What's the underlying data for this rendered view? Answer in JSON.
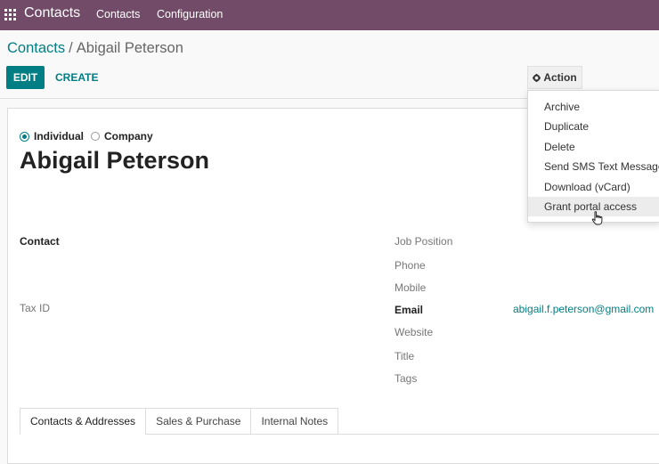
{
  "navbar": {
    "app_title": "Contacts",
    "menu": [
      "Contacts",
      "Configuration"
    ],
    "color": "#714b67"
  },
  "breadcrumb": {
    "parent": "Contacts",
    "separator": "/",
    "current": "Abigail Peterson"
  },
  "toolbar": {
    "edit_label": "EDIT",
    "create_label": "CREATE",
    "action_label": "Action",
    "accent": "#017e84"
  },
  "action_menu": {
    "items": [
      "Archive",
      "Duplicate",
      "Delete",
      "Send SMS Text Message",
      "Download (vCard)",
      "Grant portal access"
    ],
    "hovered_item": "Grant portal access"
  },
  "form": {
    "company_type": {
      "options": [
        "Individual",
        "Company"
      ],
      "selected": "Individual"
    },
    "name": "Abigail Peterson",
    "left_labels": {
      "contact": "Contact",
      "tax_id": "Tax ID"
    },
    "right_labels": {
      "job_position": "Job Position",
      "phone": "Phone",
      "mobile": "Mobile",
      "email": "Email",
      "website": "Website",
      "title": "Title",
      "tags": "Tags"
    },
    "email_value": "abigail.f.peterson@gmail.com"
  },
  "tabs": {
    "items": [
      "Contacts & Addresses",
      "Sales & Purchase",
      "Internal Notes"
    ],
    "active": "Contacts & Addresses"
  }
}
